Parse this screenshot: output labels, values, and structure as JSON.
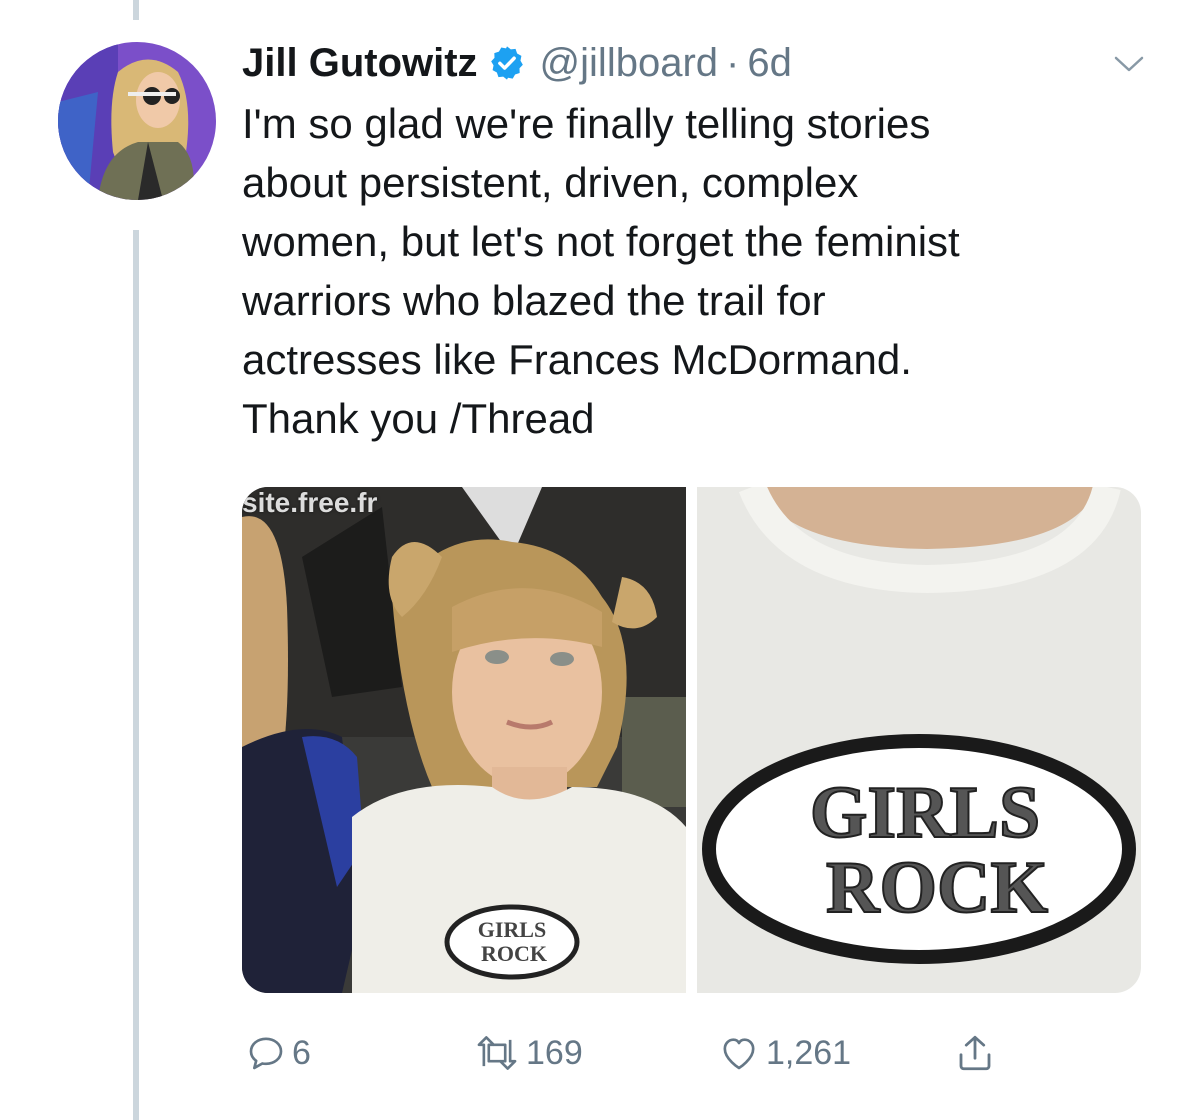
{
  "tweet": {
    "author_name": "Jill Gutowitz",
    "handle": "@jillboard",
    "separator": "·",
    "time": "6d",
    "text_lines": [
      "I'm so glad we're finally telling stories",
      "about persistent, driven, complex",
      "women, but let's not forget the feminist",
      "warriors who blazed the trail for",
      "actresses like Frances McDormand.",
      "Thank you /Thread"
    ]
  },
  "media": {
    "watermark": "site.free.fr",
    "shirt_text_line1": "GIRLS",
    "shirt_text_line2": "ROCK"
  },
  "actions": {
    "replies": "6",
    "retweets": "169",
    "likes": "1,261"
  },
  "colors": {
    "verified_blue": "#1da1f2",
    "secondary_text": "#657786",
    "primary_text": "#14171a",
    "thread_line": "#ccd6dd"
  },
  "icons": {
    "reply": "reply-icon",
    "retweet": "retweet-icon",
    "like": "heart-icon",
    "share": "share-icon",
    "verified": "verified-badge-icon",
    "more": "chevron-down-icon"
  }
}
